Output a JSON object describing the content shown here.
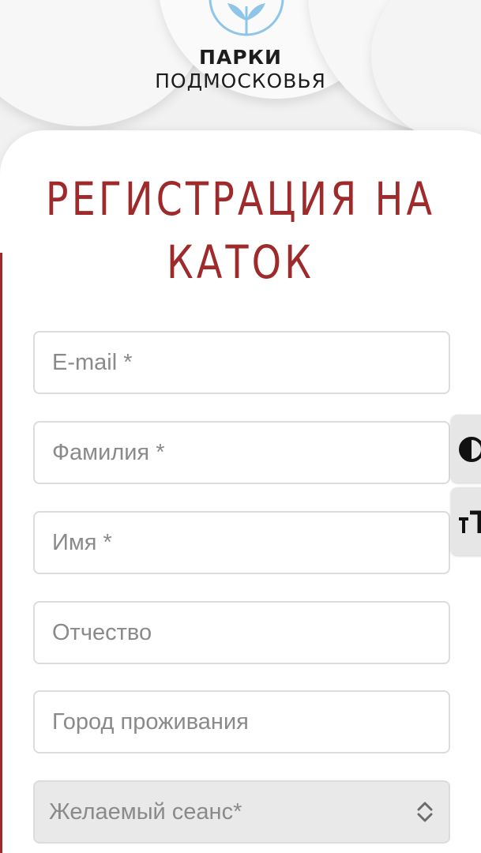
{
  "logo": {
    "line1": "ПАРКИ",
    "line2": "ПОДМОСКОВЬЯ",
    "emblem_icon": "leaf-emblem-icon",
    "emblem_color": "#8ec5e8"
  },
  "form": {
    "title": "РЕГИСТРАЦИЯ НА КАТОК",
    "title_color": "#9e2a2b",
    "fields": [
      {
        "placeholder": "E-mail *",
        "value": ""
      },
      {
        "placeholder": "Фамилия *",
        "value": ""
      },
      {
        "placeholder": "Имя *",
        "value": ""
      },
      {
        "placeholder": "Отчество",
        "value": ""
      },
      {
        "placeholder": "Город проживания",
        "value": ""
      }
    ],
    "session_select": {
      "selected": "Желаемый сеанс*",
      "icon": "chevron-updown-icon"
    }
  },
  "accessibility": {
    "contrast_icon": "contrast-icon",
    "font_size_icon": "font-size-icon"
  }
}
